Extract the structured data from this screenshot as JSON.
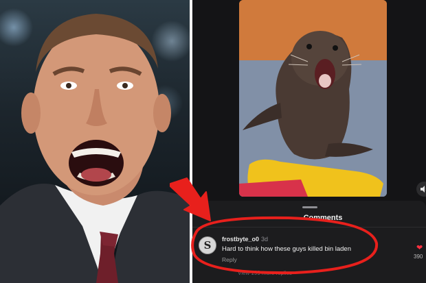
{
  "video": {
    "volume_icon": "speaker-icon"
  },
  "sheet": {
    "title": "Comments"
  },
  "comment": {
    "avatar_letter": "S",
    "username": "frostbyte_o0",
    "time": "3d",
    "text": "Hard to think how these guys killed bin laden",
    "reply_label": "Reply",
    "like_icon": "heart-icon",
    "like_count": "390"
  },
  "view_replies": "View 199 more replies",
  "colors": {
    "annotation_red": "#e8201c",
    "like_red": "#ff3040",
    "app_background": "#141416"
  }
}
